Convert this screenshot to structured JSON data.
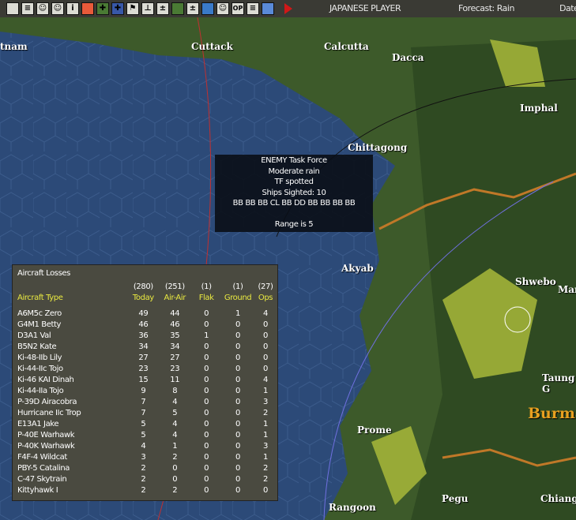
{
  "toolbar": {
    "player": "JAPANESE PLAYER",
    "forecast": "Forecast: Rain",
    "date": "Date",
    "buttons": [
      "info",
      "list",
      "group",
      "group2",
      "i",
      "rising-sun",
      "air-green",
      "air-blue",
      "flag",
      "ship",
      "ship2",
      "ground",
      "base",
      "globe",
      "group3",
      "OP",
      "report",
      "sky"
    ]
  },
  "map_labels": [
    "tnam",
    "Cuttack",
    "Calcutta",
    "Dacca",
    "Imphal",
    "Chittagong",
    "Akyab",
    "Shwebo",
    "Man",
    "Taung G",
    "Prome",
    "Burma",
    "Pegu",
    "Rangoon",
    "Chiang"
  ],
  "tooltip": {
    "lines": [
      "ENEMY Task Force",
      "Moderate rain",
      "TF spotted",
      "Ships Sighted: 10",
      "BB BB BB CL BB DD BB BB BB BB",
      "",
      "Range is 5"
    ]
  },
  "losses": {
    "title": "Aircraft Losses",
    "totals": [
      "(280)",
      "(251)",
      "(1)",
      "(1)",
      "(27)"
    ],
    "headers": [
      "Aircraft Type",
      "Today",
      "Air-Air",
      "Flak",
      "Ground",
      "Ops"
    ],
    "rows": [
      [
        "A6M5c Zero",
        "49",
        "44",
        "0",
        "1",
        "4"
      ],
      [
        "G4M1 Betty",
        "46",
        "46",
        "0",
        "0",
        "0"
      ],
      [
        "D3A1 Val",
        "36",
        "35",
        "1",
        "0",
        "0"
      ],
      [
        "B5N2 Kate",
        "34",
        "34",
        "0",
        "0",
        "0"
      ],
      [
        "Ki-48-IIb Lily",
        "27",
        "27",
        "0",
        "0",
        "0"
      ],
      [
        "Ki-44-IIc Tojo",
        "23",
        "23",
        "0",
        "0",
        "0"
      ],
      [
        "Ki-46 KAI Dinah",
        "15",
        "11",
        "0",
        "0",
        "4"
      ],
      [
        "Ki-44-IIa Tojo",
        "9",
        "8",
        "0",
        "0",
        "1"
      ],
      [
        "P-39D Airacobra",
        "7",
        "4",
        "0",
        "0",
        "3"
      ],
      [
        "Hurricane IIc Trop",
        "7",
        "5",
        "0",
        "0",
        "2"
      ],
      [
        "E13A1 Jake",
        "5",
        "4",
        "0",
        "0",
        "1"
      ],
      [
        "P-40E Warhawk",
        "5",
        "4",
        "0",
        "0",
        "1"
      ],
      [
        "P-40K Warhawk",
        "4",
        "1",
        "0",
        "0",
        "3"
      ],
      [
        "F4F-4 Wildcat",
        "3",
        "2",
        "0",
        "0",
        "1"
      ],
      [
        "PBY-5 Catalina",
        "2",
        "0",
        "0",
        "0",
        "2"
      ],
      [
        "C-47 Skytrain",
        "2",
        "0",
        "0",
        "0",
        "2"
      ],
      [
        "Kittyhawk I",
        "2",
        "2",
        "0",
        "0",
        "0"
      ]
    ]
  }
}
